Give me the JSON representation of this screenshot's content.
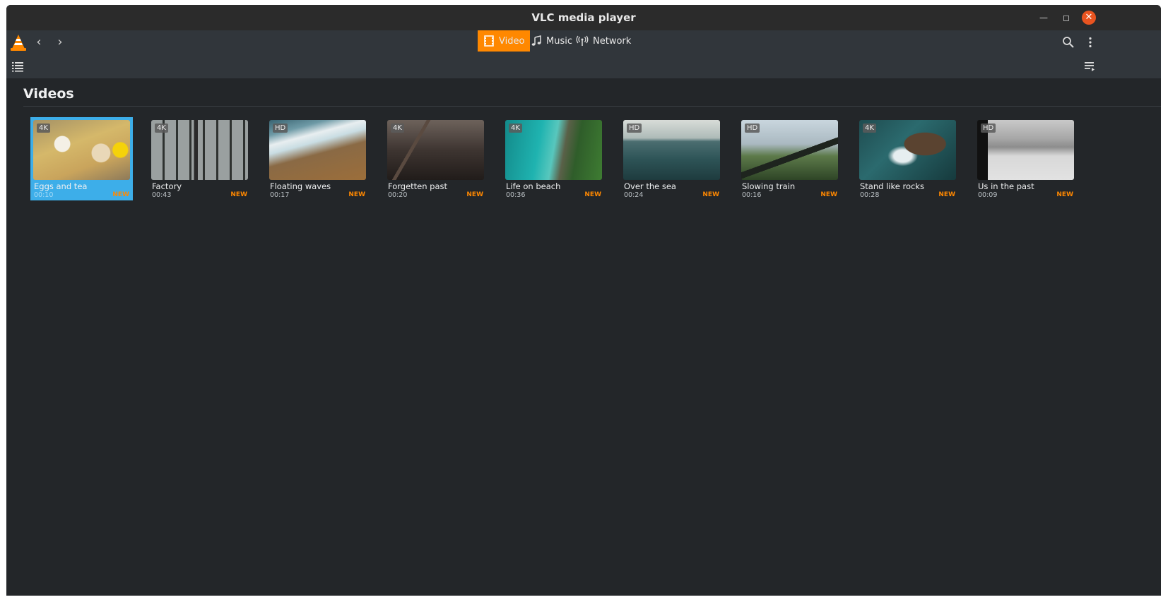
{
  "window": {
    "title": "VLC media player"
  },
  "nav": {
    "tabs": [
      {
        "label": "Video",
        "icon": "film-icon",
        "active": true
      },
      {
        "label": "Music",
        "icon": "music-note-icon",
        "active": false
      },
      {
        "label": "Network",
        "icon": "antenna-icon",
        "active": false
      }
    ]
  },
  "section": {
    "title": "Videos"
  },
  "videos": [
    {
      "title": "Eggs and tea",
      "duration": "00:10",
      "quality": "4K",
      "new_label": "NEW",
      "selected": true
    },
    {
      "title": "Factory",
      "duration": "00:43",
      "quality": "4K",
      "new_label": "NEW",
      "selected": false
    },
    {
      "title": "Floating waves",
      "duration": "00:17",
      "quality": "HD",
      "new_label": "NEW",
      "selected": false
    },
    {
      "title": "Forgetten past",
      "duration": "00:20",
      "quality": "4K",
      "new_label": "NEW",
      "selected": false
    },
    {
      "title": "Life on beach",
      "duration": "00:36",
      "quality": "4K",
      "new_label": "NEW",
      "selected": false
    },
    {
      "title": "Over the sea",
      "duration": "00:24",
      "quality": "HD",
      "new_label": "NEW",
      "selected": false
    },
    {
      "title": "Slowing train",
      "duration": "00:16",
      "quality": "HD",
      "new_label": "NEW",
      "selected": false
    },
    {
      "title": "Stand like rocks",
      "duration": "00:28",
      "quality": "4K",
      "new_label": "NEW",
      "selected": false
    },
    {
      "title": "Us in the past",
      "duration": "00:09",
      "quality": "HD",
      "new_label": "NEW",
      "selected": false
    }
  ],
  "colors": {
    "accent": "#ff8800",
    "selection": "#3daee9",
    "background": "#232629",
    "toolbar": "#31363b",
    "close": "#e95420"
  }
}
